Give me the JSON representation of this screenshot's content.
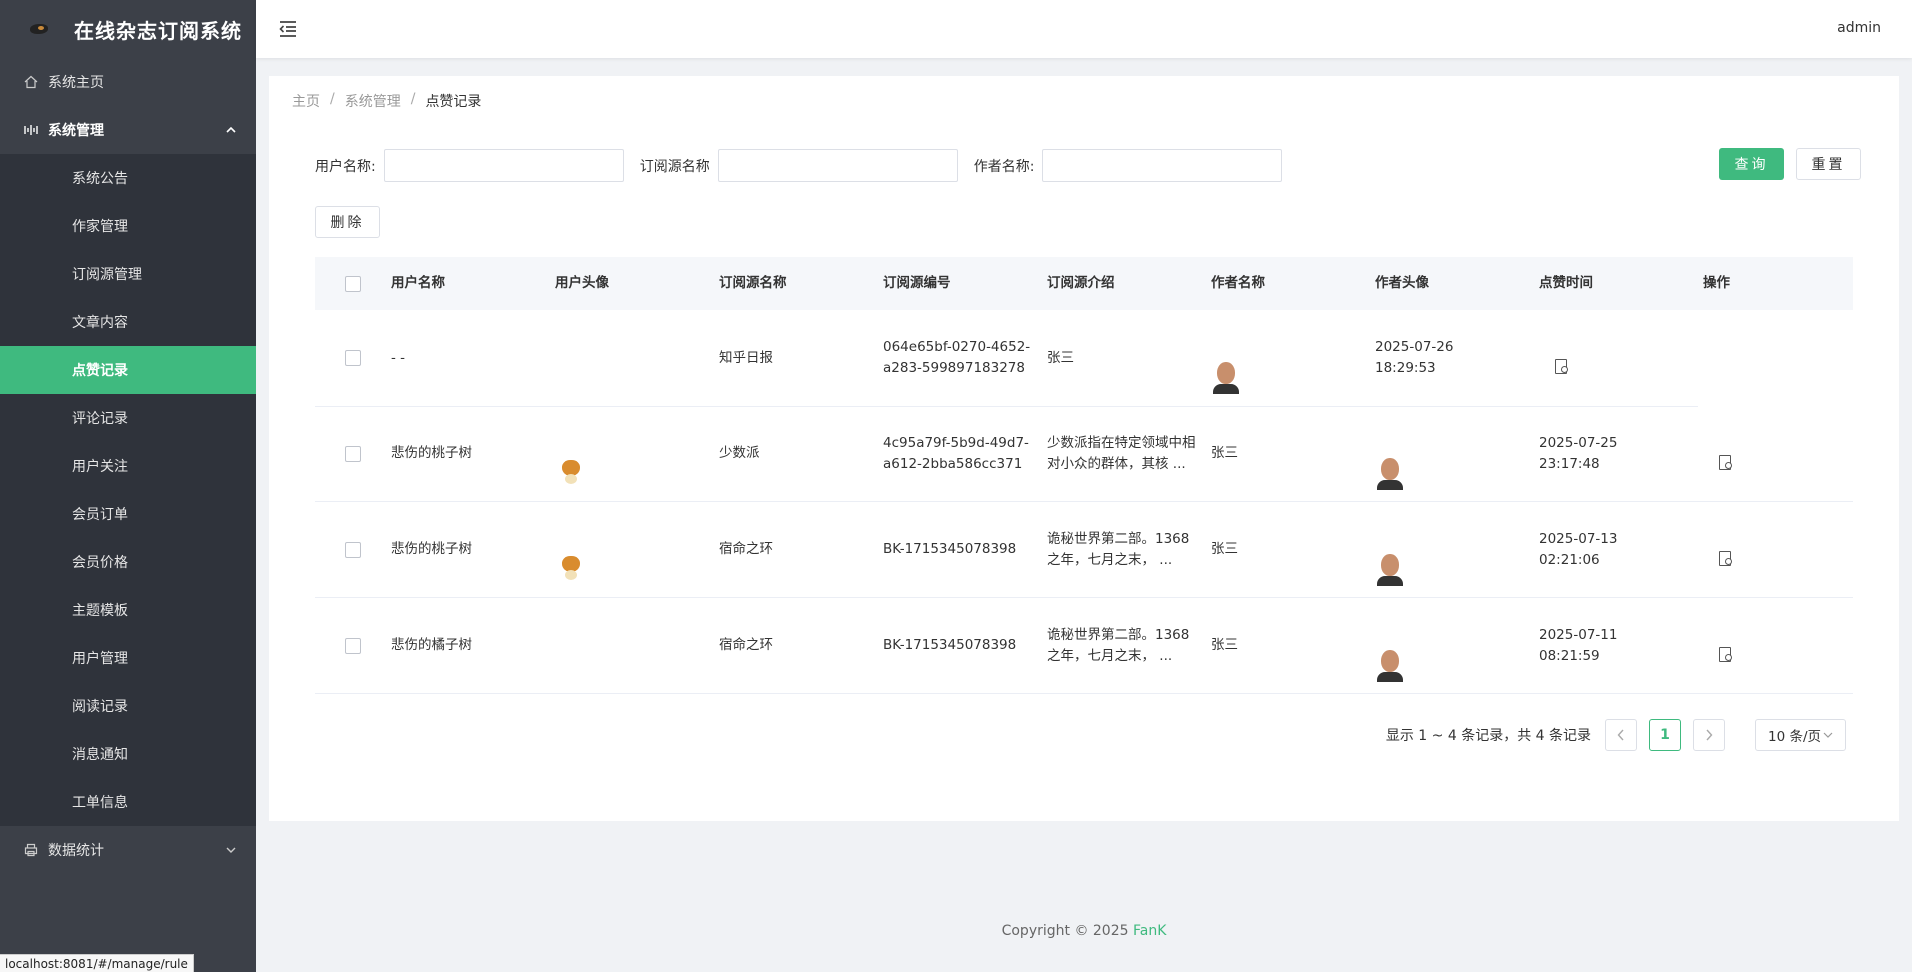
{
  "app": {
    "title": "在线杂志订阅系统"
  },
  "sidebar": {
    "home": {
      "label": "系统主页",
      "icon": "home-icon"
    },
    "system_group": {
      "label": "系统管理",
      "icon": "settings-icon",
      "expanded": true
    },
    "system_items": [
      {
        "label": "系统公告",
        "active": false
      },
      {
        "label": "作家管理",
        "active": false
      },
      {
        "label": "订阅源管理",
        "active": false
      },
      {
        "label": "文章内容",
        "active": false
      },
      {
        "label": "点赞记录",
        "active": true
      },
      {
        "label": "评论记录",
        "active": false
      },
      {
        "label": "用户关注",
        "active": false
      },
      {
        "label": "会员订单",
        "active": false
      },
      {
        "label": "会员价格",
        "active": false
      },
      {
        "label": "主题模板",
        "active": false
      },
      {
        "label": "用户管理",
        "active": false
      },
      {
        "label": "阅读记录",
        "active": false
      },
      {
        "label": "消息通知",
        "active": false
      },
      {
        "label": "工单信息",
        "active": false
      }
    ],
    "stats_group": {
      "label": "数据统计",
      "icon": "printer-icon",
      "expanded": false
    }
  },
  "header": {
    "user": "admin"
  },
  "breadcrumb": [
    "主页",
    "系统管理",
    "点赞记录"
  ],
  "filters": {
    "user_name_label": "用户名称:",
    "user_name_value": "",
    "source_name_label": "订阅源名称",
    "source_name_value": "",
    "author_name_label": "作者名称:",
    "author_name_value": "",
    "query_label": "查询",
    "reset_label": "重置"
  },
  "toolbar": {
    "delete_label": "删除"
  },
  "table": {
    "columns": [
      "用户名称",
      "用户头像",
      "订阅源名称",
      "订阅源编号",
      "订阅源介绍",
      "作者名称",
      "作者头像",
      "点赞时间",
      "操作"
    ],
    "rows": [
      {
        "user_name": "- -",
        "user_avatar": "placeholder",
        "source_name": "知乎日报",
        "source_no": "064e65bf-0270-4652-a283-599897183278",
        "source_intro": "张三",
        "author_name": "",
        "author_avatar": "man",
        "like_time": "2025-07-26 18:29:53"
      },
      {
        "user_name": "悲伤的桃子树",
        "user_avatar": "dog",
        "source_name": "少数派",
        "source_no": "4c95a79f-5b9d-49d7-a612-2bba586cc371",
        "source_intro": "少数派指在特定领域中相对小众的群体，其核 ...",
        "author_name": "张三",
        "author_avatar": "man",
        "like_time": "2025-07-25 23:17:48"
      },
      {
        "user_name": "悲伤的桃子树",
        "user_avatar": "dog",
        "source_name": "宿命之环",
        "source_no": "BK-1715345078398",
        "source_intro": "诡秘世界第二部。1368之年，七月之末， ...",
        "author_name": "张三",
        "author_avatar": "man",
        "like_time": "2025-07-13 02:21:06"
      },
      {
        "user_name": "悲伤的橘子树",
        "user_avatar": "placeholder",
        "source_name": "宿命之环",
        "source_no": "BK-1715345078398",
        "source_intro": "诡秘世界第二部。1368之年，七月之末， ...",
        "author_name": "张三",
        "author_avatar": "man",
        "like_time": "2025-07-11 08:21:59"
      }
    ]
  },
  "pagination": {
    "summary": "显示 1 ~ 4 条记录，共 4 条记录",
    "prev": "<",
    "current": "1",
    "next": ">",
    "page_size": "10 条/页"
  },
  "footer": {
    "copyright": "Copyright © 2025",
    "brand": "FanK"
  },
  "statusbar": {
    "url": "localhost:8081/#/manage/rule"
  },
  "colors": {
    "accent": "#3fba7f",
    "sidebar_bg": "#3c4048",
    "submenu_bg": "#2f333b"
  }
}
